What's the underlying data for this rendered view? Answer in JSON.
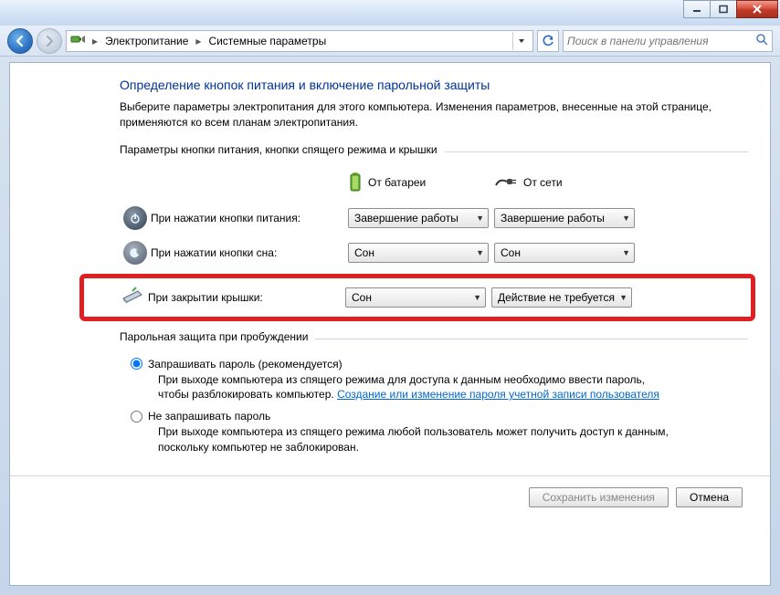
{
  "breadcrumb": {
    "level1": "Электропитание",
    "level2": "Системные параметры"
  },
  "search": {
    "placeholder": "Поиск в панели управления"
  },
  "page": {
    "title": "Определение кнопок питания и включение парольной защиты",
    "description": "Выберите параметры электропитания для этого компьютера. Изменения параметров, внесенные на этой странице, применяются ко всем планам электропитания."
  },
  "section_buttons": {
    "legend": "Параметры кнопки питания, кнопки спящего режима и крышки",
    "col_battery": "От батареи",
    "col_ac": "От сети",
    "rows": {
      "power_btn": {
        "label": "При нажатии кнопки питания:",
        "battery": "Завершение работы",
        "ac": "Завершение работы"
      },
      "sleep_btn": {
        "label": "При нажатии кнопки сна:",
        "battery": "Сон",
        "ac": "Сон"
      },
      "lid": {
        "label": "При закрытии крышки:",
        "battery": "Сон",
        "ac": "Действие не требуется"
      }
    }
  },
  "section_password": {
    "legend": "Парольная защита при пробуждении",
    "opt_require": {
      "label": "Запрашивать пароль (рекомендуется)",
      "desc_before": "При выходе компьютера из спящего режима для доступа к данным необходимо ввести пароль, чтобы разблокировать компьютер. ",
      "link": "Создание или изменение пароля учетной записи пользователя"
    },
    "opt_norequire": {
      "label": "Не запрашивать пароль",
      "desc": "При выходе компьютера из спящего режима любой пользователь может получить доступ к данным, поскольку компьютер не заблокирован."
    }
  },
  "footer": {
    "save": "Сохранить изменения",
    "cancel": "Отмена"
  }
}
